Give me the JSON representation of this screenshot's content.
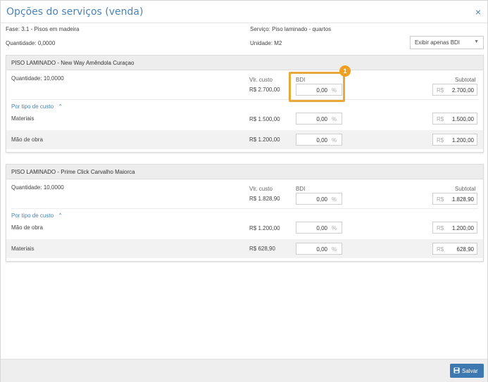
{
  "dialog": {
    "title": "Opções do serviços (venda)",
    "close_icon": "×"
  },
  "info": {
    "fase": "Fase: 3.1 - Pisos em madeira",
    "quantidade": "Quantidade: 0,0000",
    "servico": "Serviço: Piso laminado - quartos",
    "unidade": "Unidade: M2"
  },
  "filter": {
    "selected": "Exibir apenas BDI",
    "caret": "▼"
  },
  "labels": {
    "vlr_custo": "Vlr. custo",
    "bdi": "BDI",
    "subtotal": "Subtotal",
    "por_tipo": "Por tipo de custo",
    "chevron": "⌃",
    "percent": "%",
    "currency": "R$"
  },
  "cards": [
    {
      "title": "PISO LAMINADO - New Way Amêndola Curaçao",
      "quantidade": "Quantidade: 10,0000",
      "custo": "R$ 2.700,00",
      "bdi": "0,00",
      "subtotal": "2.700,00",
      "rows": [
        {
          "name": "Materiais",
          "custo": "R$ 1.500,00",
          "bdi": "0,00",
          "subtotal": "1.500,00"
        },
        {
          "name": "Mão de obra",
          "custo": "R$ 1.200,00",
          "bdi": "0,00",
          "subtotal": "1.200,00"
        }
      ]
    },
    {
      "title": "PISO LAMINADO - Prime Click Carvalho Maiorca",
      "quantidade": "Quantidade: 10,0000",
      "custo": "R$ 1.828,90",
      "bdi": "0,00",
      "subtotal": "1.828,90",
      "rows": [
        {
          "name": "Mão de obra",
          "custo": "R$ 1.200,00",
          "bdi": "0,00",
          "subtotal": "1.200,00"
        },
        {
          "name": "Materiais",
          "custo": "R$ 628,90",
          "bdi": "0,00",
          "subtotal": "628,90"
        }
      ]
    }
  ],
  "annotation": {
    "badge": "1",
    "color": "#e8a93a"
  },
  "footer": {
    "save_label": "Salvar"
  },
  "colors": {
    "accent": "#4a83b8",
    "button": "#3d79b0",
    "highlight": "#e8a93a"
  }
}
